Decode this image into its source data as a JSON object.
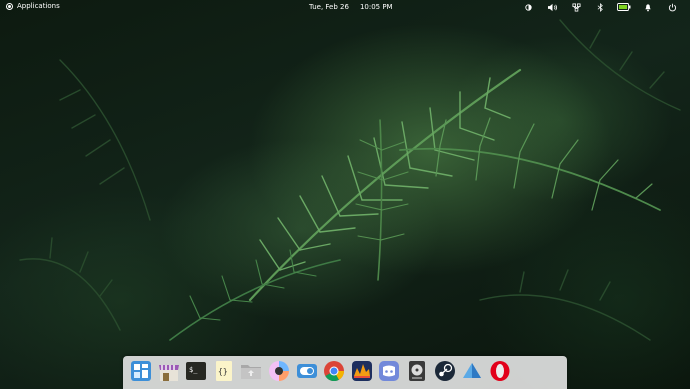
{
  "panel": {
    "applications_label": "Applications",
    "date": "Tue, Feb 26",
    "time": "10:05 PM",
    "tray_icons": [
      "night-light-icon",
      "volume-icon",
      "wifi-icon",
      "bluetooth-icon",
      "battery-icon",
      "notifications-icon",
      "power-icon"
    ]
  },
  "dock": {
    "apps": [
      {
        "name": "multitasking-view",
        "icon": "multitasking-icon"
      },
      {
        "name": "appcenter",
        "icon": "store-icon"
      },
      {
        "name": "terminal",
        "icon": "terminal-icon"
      },
      {
        "name": "code",
        "icon": "code-icon"
      },
      {
        "name": "files",
        "icon": "folder-icon"
      },
      {
        "name": "palette",
        "icon": "palette-icon"
      },
      {
        "name": "system-settings",
        "icon": "toggle-icon"
      },
      {
        "name": "chrome",
        "icon": "chrome-icon"
      },
      {
        "name": "audacious",
        "icon": "audio-icon"
      },
      {
        "name": "discord",
        "icon": "discord-icon"
      },
      {
        "name": "disk-utility",
        "icon": "disk-icon"
      },
      {
        "name": "steam",
        "icon": "steam-icon"
      },
      {
        "name": "sideload",
        "icon": "sideload-icon"
      },
      {
        "name": "opera",
        "icon": "opera-icon"
      }
    ]
  },
  "colors": {
    "panel_text": "#ffffff",
    "dock_bg": "#ebebeb",
    "wallpaper_green": "#3f7a45"
  }
}
